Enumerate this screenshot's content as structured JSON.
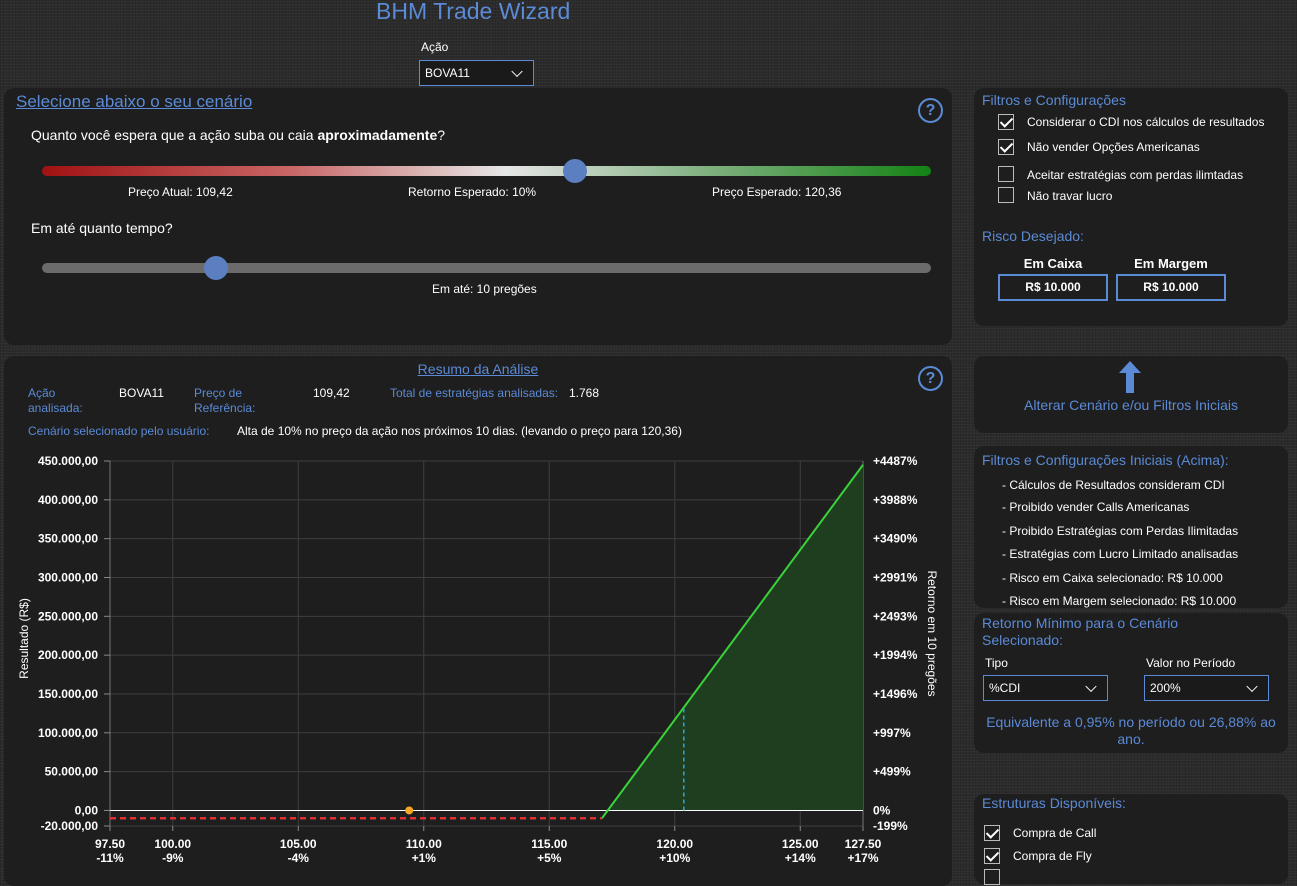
{
  "app_title": "BHM Trade Wizard",
  "acao": {
    "label": "Ação",
    "value": "BOVA11"
  },
  "scenario": {
    "title": "Selecione abaixo o seu cenário",
    "question_pre": "Quanto você espera que a ação suba ou caia ",
    "question_bold": "aproximadamente",
    "question_post": "?",
    "price_slider": {
      "current_label": "Preço Atual: 109,42",
      "expected_return_label": "Retorno Esperado: 10%",
      "expected_price_label": "Preço Esperado: 120,36",
      "position_fraction": 0.6
    },
    "time_question": "Em até quanto tempo?",
    "time_slider": {
      "label": "Em até: 10 pregões",
      "position_fraction": 0.196
    },
    "help": "?"
  },
  "filters": {
    "title": "Filtros e Configurações",
    "items": [
      {
        "label": "Considerar o CDI nos cálculos de resultados",
        "checked": true
      },
      {
        "label": "Não vender Opções Americanas",
        "checked": true
      },
      {
        "label": "Aceitar estratégias com perdas ilimtadas",
        "checked": false
      },
      {
        "label": "Não travar lucro",
        "checked": false
      }
    ],
    "risk_title": "Risco Desejado:",
    "risk_caixa_label": "Em Caixa",
    "risk_caixa_value": "R$ 10.000",
    "risk_margem_label": "Em Margem",
    "risk_margem_value": "R$ 10.000"
  },
  "alter_button": "Alterar Cenário e/ou Filtros Iniciais",
  "summary": {
    "title": "Resumo da Análise",
    "acao_label": "Ação analisada:",
    "acao_value": "BOVA11",
    "preco_label": "Preço de Referência:",
    "preco_value": "109,42",
    "total_label": "Total de estratégias analisadas:",
    "total_value": "1.768",
    "cenario_label": "Cenário selecionado pelo usuário:",
    "cenario_value": "Alta de 10% no preço da ação nos próximos 10 dias. (levando o preço para 120,36)",
    "help": "?"
  },
  "initial_filters": {
    "title": "Filtros e Configurações Iniciais (Acima):",
    "items": [
      "- Cálculos de Resultados consideram CDI",
      "- Proibido vender Calls Americanas",
      "- Proibido Estratégias com Perdas Ilimitadas",
      "- Estratégias com Lucro Limitado analisadas",
      "- Risco em Caixa selecionado: R$ 10.000",
      "- Risco em Margem selecionado: R$ 10.000"
    ]
  },
  "min_return": {
    "title": "Retorno Mínimo para o Cenário Selecionado:",
    "tipo_label": "Tipo",
    "tipo_value": "%CDI",
    "valor_label": "Valor no Período",
    "valor_value": "200%",
    "equivalente": "Equivalente a 0,95% no período ou 26,88% ao ano."
  },
  "structures": {
    "title": "Estruturas Disponíveis:",
    "items": [
      {
        "label": "Compra de Call",
        "checked": true
      },
      {
        "label": "Compra de Fly",
        "checked": true
      }
    ]
  },
  "chart_data": {
    "type": "area",
    "ylabel": "Resultado (R$)",
    "y2label": "Retorno em 10 pregões",
    "ylim": [
      -20000,
      450000
    ],
    "xlim": [
      97.5,
      127.5
    ],
    "y_ticks": [
      {
        "v": 450000,
        "l": "450.000,00",
        "r": "+4487%"
      },
      {
        "v": 400000,
        "l": "400.000,00",
        "r": "+3988%"
      },
      {
        "v": 350000,
        "l": "350.000,00",
        "r": "+3490%"
      },
      {
        "v": 300000,
        "l": "300.000,00",
        "r": "+2991%"
      },
      {
        "v": 250000,
        "l": "250.000,00",
        "r": "+2493%"
      },
      {
        "v": 200000,
        "l": "200.000,00",
        "r": "+1994%"
      },
      {
        "v": 150000,
        "l": "150.000,00",
        "r": "+1496%"
      },
      {
        "v": 100000,
        "l": "100.000,00",
        "r": "+997%"
      },
      {
        "v": 50000,
        "l": "50.000,00",
        "r": "+499%"
      },
      {
        "v": 0,
        "l": "0,00",
        "r": "0%"
      },
      {
        "v": -20000,
        "l": "-20.000,00",
        "r": "-199%"
      }
    ],
    "x_ticks": [
      {
        "v": 97.5,
        "l": "97.50",
        "p": "-11%"
      },
      {
        "v": 100,
        "l": "100.00",
        "p": "-9%"
      },
      {
        "v": 105,
        "l": "105.00",
        "p": "-4%"
      },
      {
        "v": 110,
        "l": "110.00",
        "p": "+1%"
      },
      {
        "v": 115,
        "l": "115.00",
        "p": "+5%"
      },
      {
        "v": 120,
        "l": "120.00",
        "p": "+10%"
      },
      {
        "v": 125,
        "l": "125.00",
        "p": "+14%"
      },
      {
        "v": 127.5,
        "l": "127.50",
        "p": "+17%"
      }
    ],
    "payoff": [
      [
        97.5,
        -10000
      ],
      [
        117.1,
        -10000
      ],
      [
        127.5,
        445000
      ]
    ],
    "current_price": 109.42,
    "expected_price": 120.36,
    "colors": {
      "profit": "#3ad23a",
      "loss": "#e03030",
      "profit_fill": "#1f3d1f",
      "marker": "#f5a623",
      "expected": "#2aa6e0"
    }
  }
}
